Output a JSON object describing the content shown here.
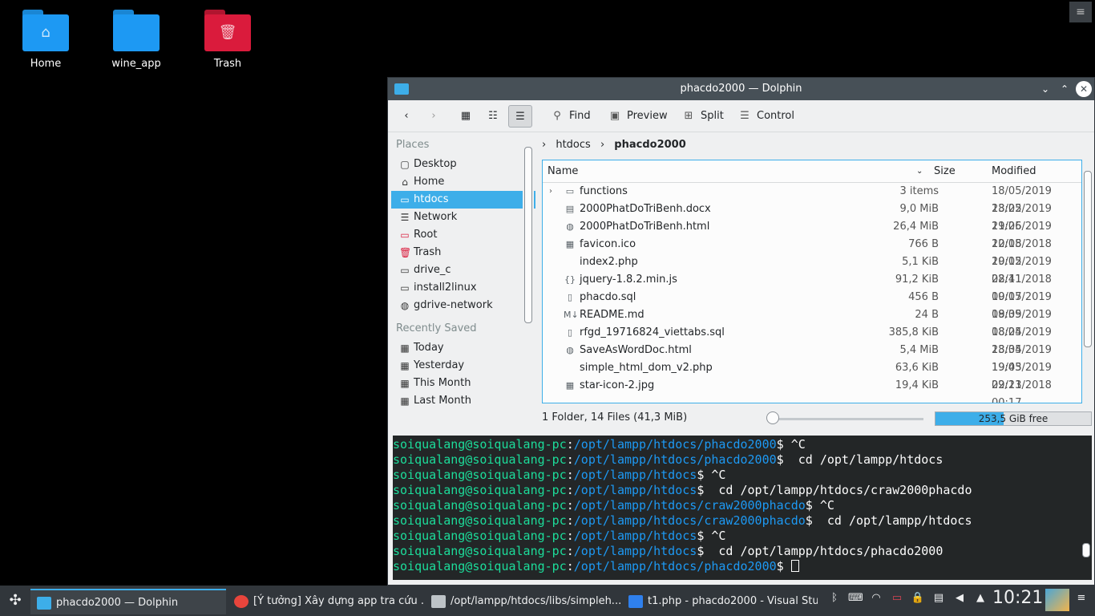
{
  "desktop": {
    "icons": [
      {
        "label": "Home",
        "color": "#1d99f3",
        "glyph": "home-icon"
      },
      {
        "label": "wine_app",
        "color": "#1d99f3",
        "glyph": "folder-icon"
      },
      {
        "label": "Trash",
        "color": "#da1b3c",
        "glyph": "trash-icon"
      }
    ]
  },
  "window": {
    "title": "phacdo2000 — Dolphin",
    "toolbar": {
      "find": "Find",
      "preview": "Preview",
      "split": "Split",
      "control": "Control"
    },
    "places": {
      "heading": "Places",
      "items": [
        "Desktop",
        "Home",
        "htdocs",
        "Network",
        "Root",
        "Trash",
        "drive_c",
        "install2linux",
        "gdrive-network"
      ],
      "selected": "htdocs",
      "recent_heading": "Recently Saved",
      "recent": [
        "Today",
        "Yesterday",
        "This Month",
        "Last Month"
      ]
    },
    "breadcrumb": [
      "htdocs",
      "phacdo2000"
    ],
    "columns": {
      "name": "Name",
      "size": "Size",
      "modified": "Modified"
    },
    "files": [
      {
        "name": "functions",
        "size": "3 items",
        "modified": "18/05/2019 23:22",
        "type": "folder"
      },
      {
        "name": "2000PhatDoTriBenh.docx",
        "size": "9,0 MiB",
        "modified": "18/05/2019 21:26",
        "type": "doc"
      },
      {
        "name": "2000PhatDoTriBenh.html",
        "size": "26,4 MiB",
        "modified": "19/05/2019 10:15",
        "type": "web"
      },
      {
        "name": "favicon.ico",
        "size": "766 B",
        "modified": "22/08/2018 20:12",
        "type": "image"
      },
      {
        "name": "index2.php",
        "size": "5,1 KiB",
        "modified": "19/05/2019 08:41",
        "type": "code"
      },
      {
        "name": "jquery-1.8.2.min.js",
        "size": "91,2 KiB",
        "modified": "22/11/2018 00:17",
        "type": "script"
      },
      {
        "name": "phacdo.sql",
        "size": "456 B",
        "modified": "19/05/2019 08:39",
        "type": "file"
      },
      {
        "name": "README.md",
        "size": "24 B",
        "modified": "19/05/2019 08:24",
        "type": "markdown"
      },
      {
        "name": "rfgd_19716824_viettabs.sql",
        "size": "385,8 KiB",
        "modified": "18/05/2019 23:34",
        "type": "file"
      },
      {
        "name": "SaveAsWordDoc.html",
        "size": "5,4 MiB",
        "modified": "18/05/2019 19:43",
        "type": "web"
      },
      {
        "name": "simple_html_dom_v2.php",
        "size": "63,6 KiB",
        "modified": "19/05/2019 09:23",
        "type": "code"
      },
      {
        "name": "star-icon-2.jpg",
        "size": "19,4 KiB",
        "modified": "22/11/2018 00:17",
        "type": "image"
      }
    ],
    "status": {
      "summary": "1 Folder, 14 Files (41,3 MiB)",
      "free": "253,5 GiB free",
      "used_fraction": 0.44
    },
    "terminal": {
      "user": "soiqualang@soiqualang-pc",
      "lines": [
        {
          "path": "/opt/lampp/htdocs/phacdo2000",
          "cmd": " ^C"
        },
        {
          "path": "/opt/lampp/htdocs/phacdo2000",
          "cmd": "  cd /opt/lampp/htdocs"
        },
        {
          "path": "/opt/lampp/htdocs",
          "cmd": " ^C"
        },
        {
          "path": "/opt/lampp/htdocs",
          "cmd": "  cd /opt/lampp/htdocs/craw2000phacdo"
        },
        {
          "path": "/opt/lampp/htdocs/craw2000phacdo",
          "cmd": " ^C"
        },
        {
          "path": "/opt/lampp/htdocs/craw2000phacdo",
          "cmd": "  cd /opt/lampp/htdocs"
        },
        {
          "path": "/opt/lampp/htdocs",
          "cmd": " ^C"
        },
        {
          "path": "/opt/lampp/htdocs",
          "cmd": "  cd /opt/lampp/htdocs/phacdo2000"
        },
        {
          "path": "/opt/lampp/htdocs/phacdo2000",
          "cmd": " "
        }
      ]
    }
  },
  "taskbar": {
    "tasks": [
      {
        "label": "phacdo2000 — Dolphin",
        "color": "#3daee9"
      },
      {
        "label": "[Ý tưởng] Xây dựng app tra cứu ...",
        "color": "#e8453c"
      },
      {
        "label": "/opt/lampp/htdocs/libs/simpleh...",
        "color": "#bdc3c7"
      },
      {
        "label": "t1.php - phacdo2000 - Visual Stu...",
        "color": "#2f80ed"
      }
    ],
    "clock": "10:21"
  }
}
